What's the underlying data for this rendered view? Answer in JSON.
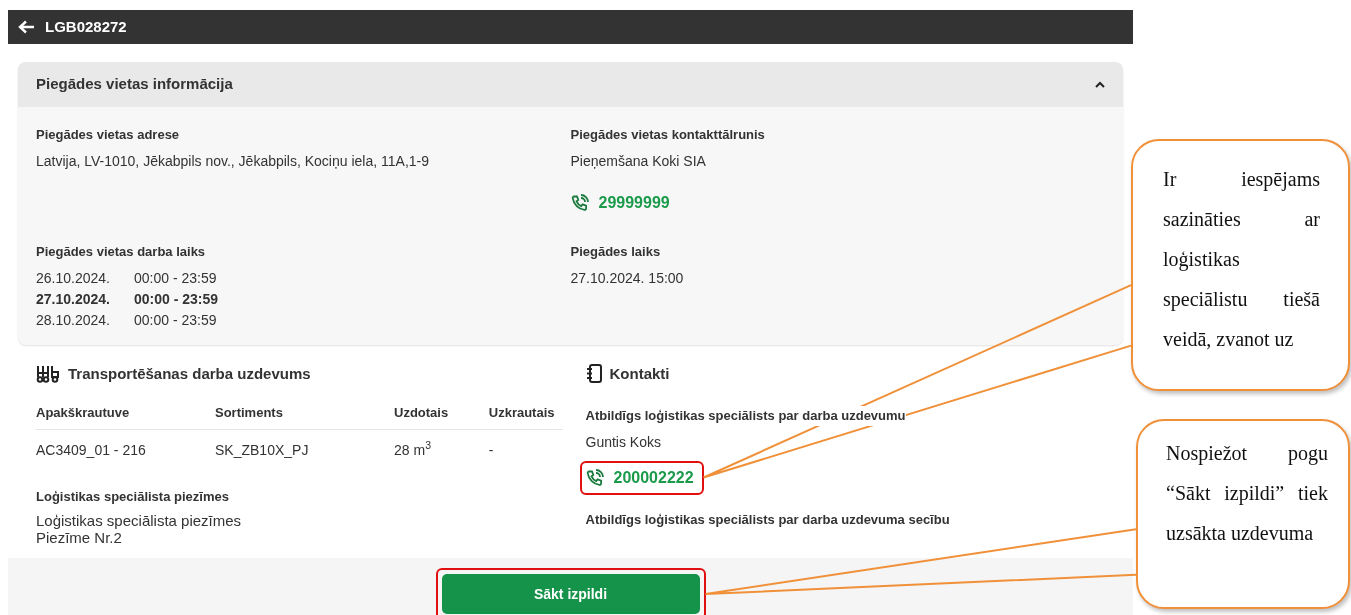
{
  "header": {
    "title": "LGB028272"
  },
  "delivery_info": {
    "title": "Piegādes vietas informācija",
    "expanded": true,
    "address": {
      "label": "Piegādes vietas adrese",
      "value": "Latvija, LV-1010, Jēkabpils nov., Jēkabpils, Kociņu iela, 11A,1-9"
    },
    "contact": {
      "label": "Piegādes vietas kontakttālrunis",
      "name": "Pieņemšana Koki SIA",
      "phone": "29999999",
      "highlighted": false
    },
    "working_hours": {
      "label": "Piegādes vietas darba laiks",
      "days": [
        {
          "date": "26.10.2024.",
          "time": "00:00 - 23:59",
          "current": false
        },
        {
          "date": "27.10.2024.",
          "time": "00:00 - 23:59",
          "current": true
        },
        {
          "date": "28.10.2024.",
          "time": "00:00 - 23:59",
          "current": false
        }
      ]
    },
    "delivery_time": {
      "label": "Piegādes laiks",
      "value": "27.10.2024. 15:00"
    }
  },
  "task": {
    "title": "Transportēšanas darba uzdevums",
    "table": {
      "columns": [
        "Apakškrautuve",
        "Sortiments",
        "Uzdotais",
        "Uzkrautais"
      ],
      "rows": [
        [
          "AC3409_01 - 216",
          "SK_ZB10X_PJ",
          "28 m$^{3}$",
          "-"
        ]
      ]
    },
    "notes": {
      "label": "Loģistikas speciālista piezīmes",
      "lines": [
        "Loģistikas speciālista piezīmes",
        "Piezīme Nr.2"
      ]
    }
  },
  "contacts": {
    "title": "Kontakti",
    "groups": [
      {
        "label": "Atbildīgs loģistikas speciālists par darba uzdevumu",
        "name": "Guntis Koks",
        "phone": "200002222",
        "highlighted": true
      },
      {
        "label": "Atbildīgs loģistikas speciālists par darba uzdevuma secību"
      }
    ]
  },
  "start_button": {
    "label": "Sākt izpildi",
    "highlighted": true
  },
  "callouts": [
    {
      "text": "Ir iespējams sazināties ar loģistikas speciālistu tiešā veidā, zvanot uz"
    },
    {
      "text": "Nospiežot pogu “Sākt izpildi” tiek uzsākta uzdevuma"
    }
  ]
}
